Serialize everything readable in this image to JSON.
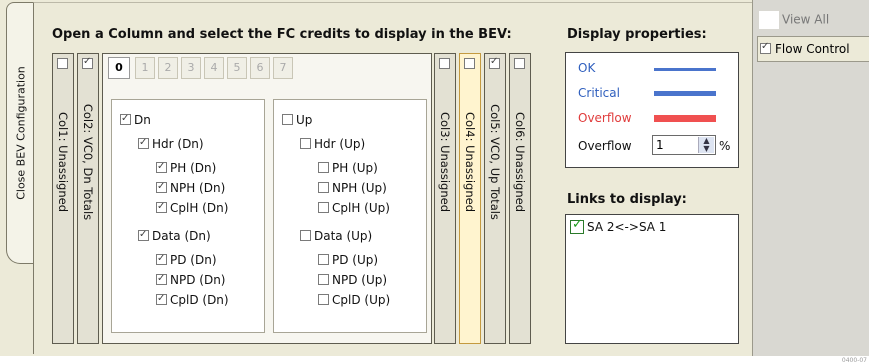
{
  "side_tab": {
    "label": "Close BEV Configuration"
  },
  "header": {
    "title": "Open a Column and select the FC credits to display in the BEV:"
  },
  "columns_left": [
    {
      "label": "Col1: Unassigned",
      "checked": false
    },
    {
      "label": "Col2: VC0, Dn Totals",
      "checked": true
    }
  ],
  "columns_right": [
    {
      "label": "Col3: Unassigned",
      "checked": false
    },
    {
      "label": "Col4: Unassigned",
      "checked": false
    },
    {
      "label": "Col5: VC0, Up Totals",
      "checked": true
    },
    {
      "label": "Col6: Unassigned",
      "checked": false
    }
  ],
  "vc_tabs": [
    "0",
    "1",
    "2",
    "3",
    "4",
    "5",
    "6",
    "7"
  ],
  "groups": {
    "dn": {
      "root": "Dn",
      "hdr": "Hdr (Dn)",
      "hdr_items": [
        "PH (Dn)",
        "NPH (Dn)",
        "CplH (Dn)"
      ],
      "data": "Data (Dn)",
      "data_items": [
        "PD (Dn)",
        "NPD (Dn)",
        "CplD (Dn)"
      ]
    },
    "up": {
      "root": "Up",
      "hdr": "Hdr (Up)",
      "hdr_items": [
        "PH (Up)",
        "NPH (Up)",
        "CplH (Up)"
      ],
      "data": "Data (Up)",
      "data_items": [
        "PD (Up)",
        "NPD (Up)",
        "CplD (Up)"
      ]
    }
  },
  "display_properties": {
    "title": "Display properties:",
    "ok": "OK",
    "critical": "Critical",
    "overflow": "Overflow",
    "overflow_threshold_label": "Overflow",
    "overflow_value": "1",
    "unit": "%",
    "colors": {
      "ok": "#4a74cc",
      "critical": "#4a74cc",
      "overflow": "#f05050",
      "ok_text": "#2f5fbe",
      "critical_text": "#2f5fbe",
      "overflow_text": "#e03c3c"
    }
  },
  "links": {
    "title": "Links to display:",
    "items": [
      {
        "label": "SA 2<->SA 1",
        "checked": true
      }
    ]
  },
  "right_panel": {
    "view_all": "View All",
    "flow_control": "Flow Control"
  },
  "figure_id": "0400-07"
}
